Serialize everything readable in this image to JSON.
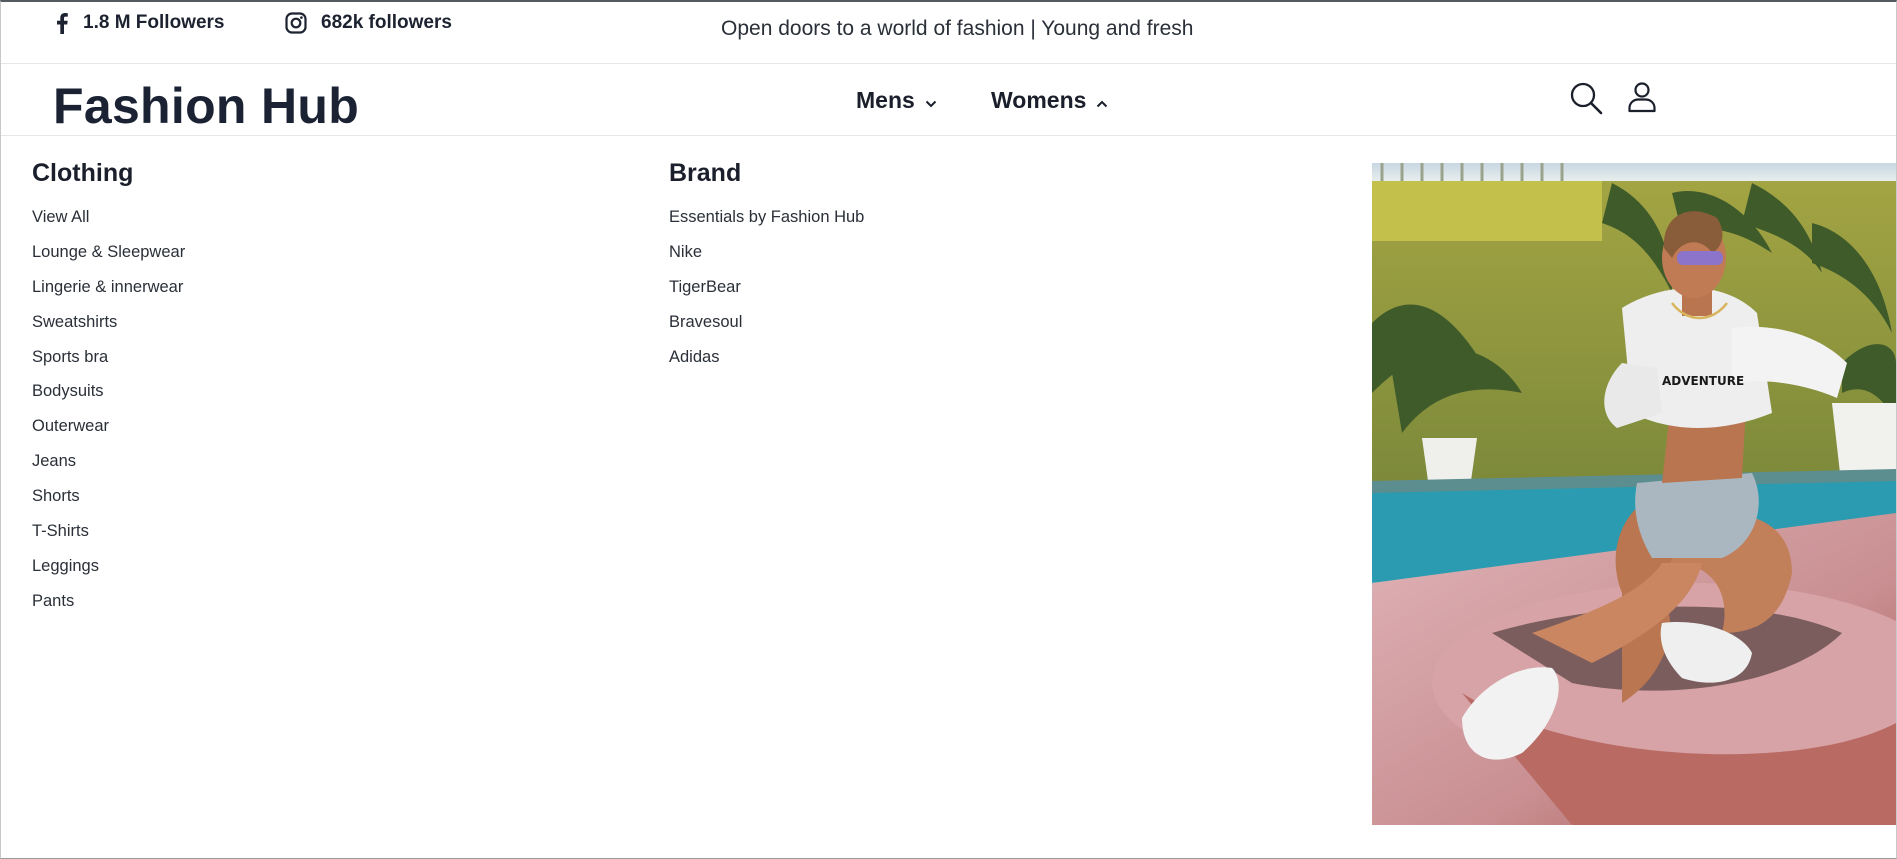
{
  "topbar": {
    "facebook_followers": "1.8 M Followers",
    "instagram_followers": "682k followers",
    "tagline": "Open doors to a world of fashion | Young and fresh",
    "icons": [
      "facebook-icon",
      "instagram-icon"
    ]
  },
  "header": {
    "logo": "Fashion Hub",
    "nav": [
      {
        "label": "Mens",
        "state": "collapsed"
      },
      {
        "label": "Womens",
        "state": "expanded"
      }
    ],
    "icons": [
      "search-icon",
      "user-icon"
    ]
  },
  "menu": {
    "clothing": {
      "title": "Clothing",
      "items": [
        "View All",
        "Lounge & Sleepwear",
        "Lingerie & innerwear",
        "Sweatshirts",
        "Sports bra",
        "Bodysuits",
        "Outerwear",
        "Jeans",
        "Shorts",
        "T-Shirts",
        "Leggings",
        "Pants"
      ]
    },
    "brand": {
      "title": "Brand",
      "items": [
        "Essentials by Fashion Hub",
        "Nike",
        "TigerBear",
        "Bravesoul",
        "Adidas"
      ]
    }
  },
  "colors": {
    "text_dark": "#1a1f2b",
    "divider": "#e4e6ea"
  }
}
